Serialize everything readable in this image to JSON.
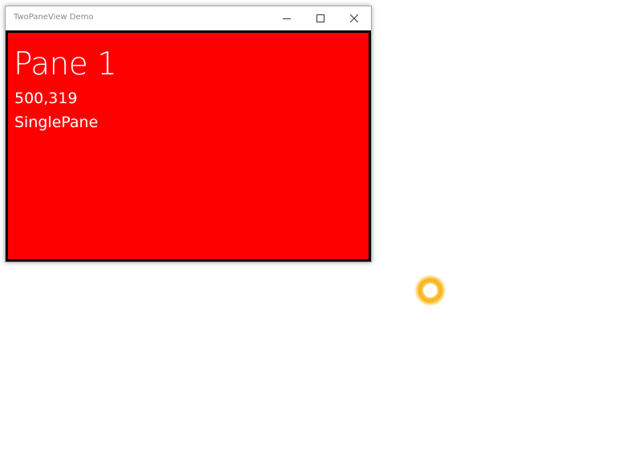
{
  "window": {
    "title": "TwoPaneView Demo",
    "controls": {
      "minimize_icon": "minimize-icon",
      "maximize_icon": "maximize-icon",
      "close_icon": "close-icon"
    }
  },
  "pane1": {
    "title": "Pane 1",
    "size": "500,319",
    "mode": "SinglePane",
    "background_color": "#ff0000",
    "border_color": "#000000"
  },
  "cursor": {
    "icon": "busy-cursor-icon",
    "color": "#f8b422"
  }
}
